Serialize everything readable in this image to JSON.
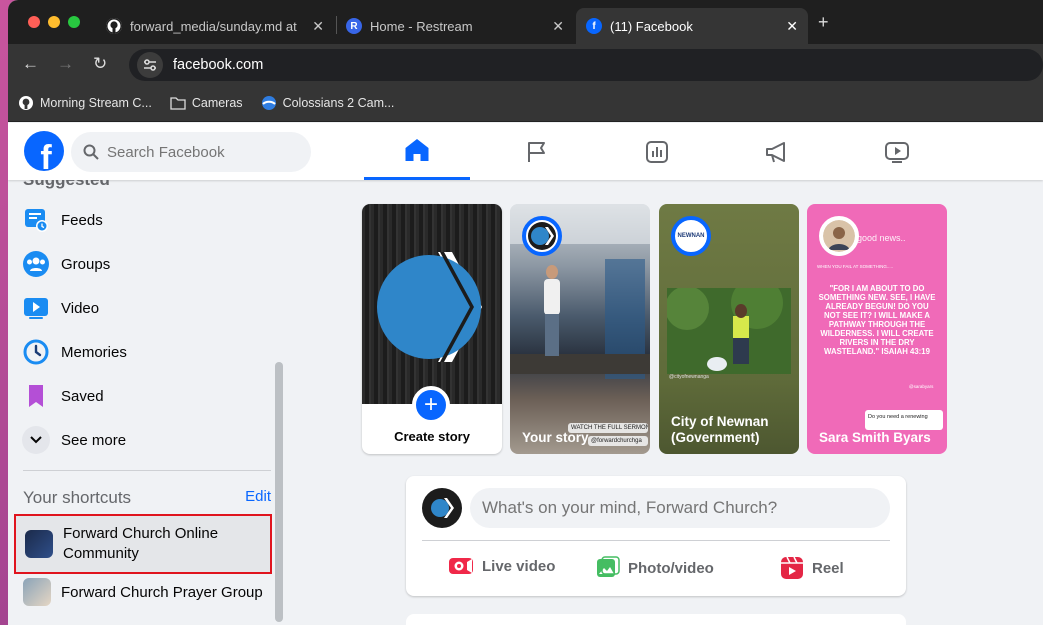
{
  "browser": {
    "tabs": [
      {
        "title": "forward_media/sunday.md at",
        "icon": "github-icon"
      },
      {
        "title": "Home - Restream",
        "icon": "restream-icon"
      },
      {
        "title": "(11) Facebook",
        "icon": "facebook-icon"
      }
    ],
    "url": "facebook.com",
    "bookmarks": [
      {
        "label": "Morning Stream C...",
        "icon": "github-icon"
      },
      {
        "label": "Cameras",
        "icon": "folder-icon"
      },
      {
        "label": "Colossians 2 Cam...",
        "icon": "colossians-icon"
      }
    ]
  },
  "facebook": {
    "logo": "f",
    "search_placeholder": "Search Facebook",
    "nav": [
      "home",
      "pages",
      "feeds",
      "ads",
      "video"
    ],
    "active_nav": "home",
    "accent": "#0866ff"
  },
  "sidebar": {
    "section_partial": "Suggested",
    "items": [
      {
        "label": "Feeds",
        "icon": "feeds-icon"
      },
      {
        "label": "Groups",
        "icon": "groups-icon"
      },
      {
        "label": "Video",
        "icon": "video-icon"
      },
      {
        "label": "Memories",
        "icon": "memories-icon"
      },
      {
        "label": "Saved",
        "icon": "saved-icon"
      },
      {
        "label": "See more",
        "icon": "chevron-down-icon"
      }
    ],
    "shortcuts_title": "Your shortcuts",
    "edit_label": "Edit",
    "shortcuts": [
      {
        "label": "Forward Church Online Community",
        "highlighted": true
      },
      {
        "label": "Forward Church Prayer Group",
        "highlighted": false
      }
    ]
  },
  "stories": [
    {
      "name": "Create story",
      "type": "create"
    },
    {
      "name": "Your story",
      "overlay": "WATCH THE FULL SERMON",
      "handle": "@forwardchurchga"
    },
    {
      "name": "City of Newnan (Government)",
      "avatar_text": "NEWNAN",
      "caption": "@cityofnewnanga"
    },
    {
      "name": "Sara Smith Byars",
      "header": "good news..",
      "subheader": "WHEN YOU FAIL AT SOMETHING.....",
      "quote": "\"FOR I AM ABOUT TO DO SOMETHING NEW. SEE, I HAVE ALREADY BEGUN! DO YOU NOT SEE IT? I WILL MAKE A PATHWAY THROUGH THE WILDERNESS. I WILL CREATE RIVERS IN THE DRY WASTELAND.\" ISAIAH 43:19",
      "handle": "@sarabyars",
      "question": "Do you need a renewing"
    }
  ],
  "composer": {
    "placeholder": "What's on your mind, Forward Church?",
    "actions": [
      {
        "label": "Live video",
        "icon": "live-video-icon",
        "color": "#f02849"
      },
      {
        "label": "Photo/video",
        "icon": "photo-icon",
        "color": "#45bd62"
      },
      {
        "label": "Reel",
        "icon": "reel-icon",
        "color": "#e42645"
      }
    ]
  }
}
